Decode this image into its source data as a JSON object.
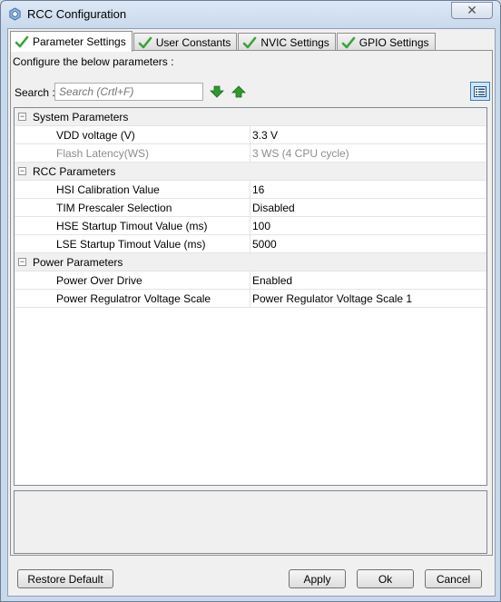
{
  "window": {
    "title": "RCC Configuration",
    "close_glyph": "✕",
    "icon": "gear-cube-icon"
  },
  "tabs": [
    {
      "label": "Parameter Settings",
      "active": true
    },
    {
      "label": "User Constants",
      "active": false
    },
    {
      "label": "NVIC Settings",
      "active": false
    },
    {
      "label": "GPIO Settings",
      "active": false
    }
  ],
  "panel": {
    "instruction": "Configure the below parameters :",
    "search_label": "Search :",
    "search_placeholder": "Search (Crtl+F)",
    "search_value": ""
  },
  "groups": [
    {
      "label": "System Parameters",
      "expander": "⊟",
      "params": [
        {
          "name": "VDD voltage (V)",
          "value": "3.3 V"
        },
        {
          "name": "Flash Latency(WS)",
          "value": "3 WS (4 CPU cycle)"
        }
      ]
    },
    {
      "label": "RCC Parameters",
      "expander": "⊟",
      "params": [
        {
          "name": "HSI Calibration Value",
          "value": "16"
        },
        {
          "name": "TIM Prescaler Selection",
          "value": "Disabled"
        },
        {
          "name": "HSE Startup Timout Value (ms)",
          "value": "100"
        },
        {
          "name": "LSE Startup Timout Value (ms)",
          "value": "5000"
        }
      ]
    },
    {
      "label": "Power Parameters",
      "expander": "⊟",
      "params": [
        {
          "name": "Power Over Drive",
          "value": "Enabled"
        },
        {
          "name": "Power Regulatror Voltage Scale",
          "value": "Power Regulator Voltage Scale 1"
        }
      ]
    }
  ],
  "buttons": {
    "restore_default": "Restore Default",
    "apply": "Apply",
    "ok": "Ok",
    "cancel": "Cancel"
  },
  "colors": {
    "check_green": "#3aa33a",
    "arrow_green": "#2e9a2e",
    "disabled_text": "#8d8d8d",
    "view_button_accent": "#3c7fb1"
  }
}
